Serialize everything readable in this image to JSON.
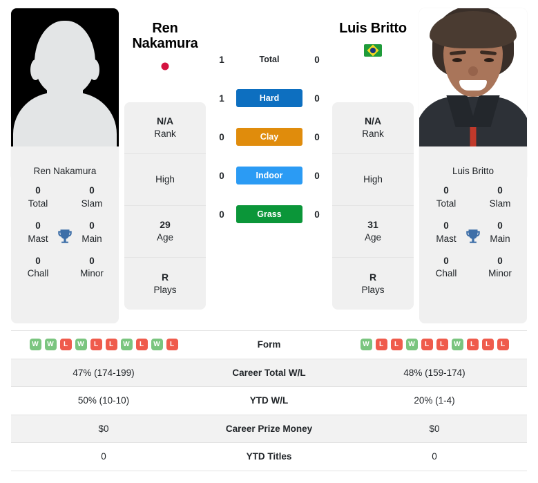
{
  "players": {
    "left": {
      "name": "Ren Nakamura",
      "name_line1": "Ren",
      "name_line2": "Nakamura",
      "photo_caption": "Ren Nakamura",
      "flag": "japan-flag",
      "photo_type": "silhouette-placeholder",
      "info": [
        {
          "value": "N/A",
          "label": "Rank"
        },
        {
          "value": "",
          "label": "High"
        },
        {
          "value": "29",
          "label": "Age"
        },
        {
          "value": "R",
          "label": "Plays"
        }
      ],
      "titles": {
        "heading": "Ren Nakamura",
        "cells": [
          {
            "value": "0",
            "label": "Total"
          },
          {
            "value": "0",
            "label": "Slam"
          },
          {
            "value": "0",
            "label": "Mast"
          },
          {
            "value": "0",
            "label": "Main"
          },
          {
            "value": "0",
            "label": "Chall"
          },
          {
            "value": "0",
            "label": "Minor"
          }
        ]
      },
      "h2h_scores": {
        "total": "1",
        "hard": "1",
        "clay": "0",
        "indoor": "0",
        "grass": "0"
      },
      "form": [
        "W",
        "W",
        "L",
        "W",
        "L",
        "L",
        "W",
        "L",
        "W",
        "L"
      ],
      "career_total_wl": "47% (174-199)",
      "ytd_wl": "50% (10-10)",
      "career_prize_money": "$0",
      "ytd_titles": "0"
    },
    "right": {
      "name": "Luis Britto",
      "name_line1": "Luis Britto",
      "name_line2": "",
      "photo_caption": "Luis Britto",
      "flag": "brazil-flag",
      "photo_type": "portrait",
      "info": [
        {
          "value": "N/A",
          "label": "Rank"
        },
        {
          "value": "",
          "label": "High"
        },
        {
          "value": "31",
          "label": "Age"
        },
        {
          "value": "R",
          "label": "Plays"
        }
      ],
      "titles": {
        "heading": "Luis Britto",
        "cells": [
          {
            "value": "0",
            "label": "Total"
          },
          {
            "value": "0",
            "label": "Slam"
          },
          {
            "value": "0",
            "label": "Mast"
          },
          {
            "value": "0",
            "label": "Main"
          },
          {
            "value": "0",
            "label": "Chall"
          },
          {
            "value": "0",
            "label": "Minor"
          }
        ]
      },
      "h2h_scores": {
        "total": "0",
        "hard": "0",
        "clay": "0",
        "indoor": "0",
        "grass": "0"
      },
      "form": [
        "W",
        "L",
        "L",
        "W",
        "L",
        "L",
        "W",
        "L",
        "L",
        "L"
      ],
      "career_total_wl": "48% (159-174)",
      "ytd_wl": "20% (1-4)",
      "career_prize_money": "$0",
      "ytd_titles": "0"
    }
  },
  "h2h_surfaces": [
    {
      "key": "total",
      "label": "Total",
      "style": "plain",
      "color": ""
    },
    {
      "key": "hard",
      "label": "Hard",
      "style": "pill",
      "color": "#0d6fc0"
    },
    {
      "key": "clay",
      "label": "Clay",
      "style": "pill",
      "color": "#e08c0c"
    },
    {
      "key": "indoor",
      "label": "Indoor",
      "style": "pill",
      "color": "#2b9bf4"
    },
    {
      "key": "grass",
      "label": "Grass",
      "style": "pill",
      "color": "#0b9639"
    }
  ],
  "stats_rows": [
    {
      "key": "form",
      "label": "Form",
      "type": "form"
    },
    {
      "key": "career_total_wl",
      "label": "Career Total W/L",
      "type": "text"
    },
    {
      "key": "ytd_wl",
      "label": "YTD W/L",
      "type": "text"
    },
    {
      "key": "career_prize_money",
      "label": "Career Prize Money",
      "type": "text"
    },
    {
      "key": "ytd_titles",
      "label": "YTD Titles",
      "type": "text"
    }
  ],
  "colors": {
    "win_badge": "#7ac57f",
    "loss_badge": "#ef5b4c",
    "card_bg": "#f0f0f0",
    "row_shade": "#f2f2f2",
    "trophy": "#3e6fa8"
  }
}
